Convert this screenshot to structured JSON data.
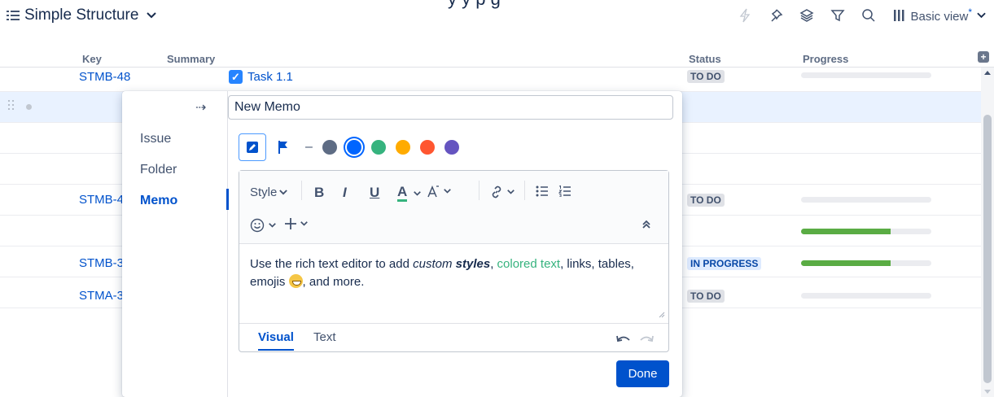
{
  "header": {
    "title": "Simple Structure",
    "cut_text": "y      y        p     g",
    "view_label": "Basic view",
    "view_modified": "*"
  },
  "table": {
    "columns": [
      "Key",
      "Summary",
      "Status",
      "Progress"
    ],
    "rows": [
      {
        "key": "STMB-48",
        "summary": "Task 1.1",
        "status": "TO DO",
        "progress": 0
      },
      {
        "key": "",
        "summary": "",
        "status": "",
        "progress": null
      },
      {
        "key": "",
        "summary": "",
        "status": "",
        "progress": null
      },
      {
        "key": "",
        "summary": "",
        "status": "",
        "progress": null
      },
      {
        "key": "STMB-4",
        "summary": "",
        "status": "TO DO",
        "progress": 0
      },
      {
        "key": "",
        "summary": "",
        "status": "",
        "progress": 0.69
      },
      {
        "key": "STMB-3",
        "summary": "",
        "status": "IN PROGRESS",
        "progress": 0.69
      },
      {
        "key": "STMA-3",
        "summary": "",
        "status": "TO DO",
        "progress": 0
      }
    ]
  },
  "popup": {
    "types": [
      "Issue",
      "Folder",
      "Memo"
    ],
    "active_type": "Memo",
    "arrow": "⇢",
    "memo_title": "New Memo",
    "colors": [
      "#5e6c84",
      "#0065ff",
      "#36b37e",
      "#ffab00",
      "#ff5630",
      "#6554c0"
    ],
    "selected_color": "#0065ff",
    "dash": "–",
    "toolbar": {
      "style_label": "Style",
      "bold": "B",
      "italic": "I",
      "underline": "U",
      "text_color": "A"
    },
    "body": {
      "part1": "Use the rich text editor to add ",
      "custom": "custom",
      "space": " ",
      "styles": "styles",
      "comma1": ", ",
      "colored": "colored text",
      "part2": ", links, tables, emojis ",
      "part3": ", and more."
    },
    "tabs": [
      "Visual",
      "Text"
    ],
    "active_tab": "Visual",
    "done_label": "Done"
  }
}
